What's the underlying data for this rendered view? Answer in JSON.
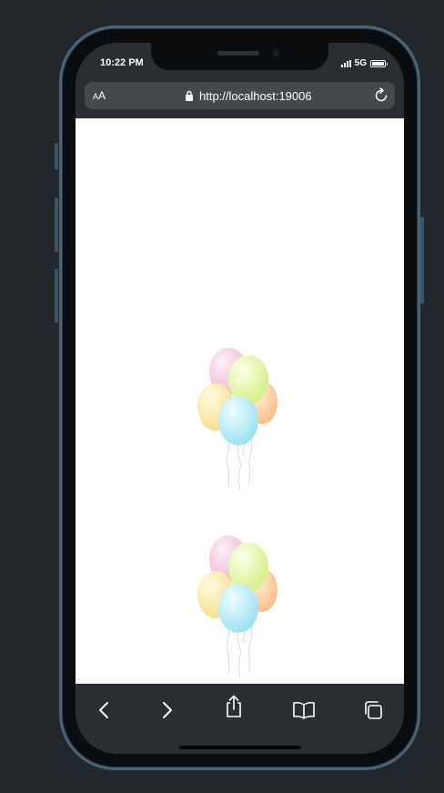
{
  "status_bar": {
    "time": "10:22 PM",
    "network": "5G"
  },
  "address_bar": {
    "text_size_label": "AA",
    "url": "http://localhost:19006",
    "lock_icon": "lock-icon",
    "reload_icon": "reload-icon"
  },
  "page": {
    "images": [
      {
        "name": "balloon-bouquet",
        "description": "balloons-image"
      },
      {
        "name": "balloon-bouquet",
        "description": "balloons-image"
      }
    ]
  },
  "toolbar": {
    "icons": [
      "back-icon",
      "forward-icon",
      "share-icon",
      "bookmarks-icon",
      "tabs-icon"
    ]
  },
  "colors": {
    "frame": "#4c6478",
    "background": "#22272b",
    "browser_chrome": "#2a2d31",
    "address_bar": "#45494e"
  }
}
